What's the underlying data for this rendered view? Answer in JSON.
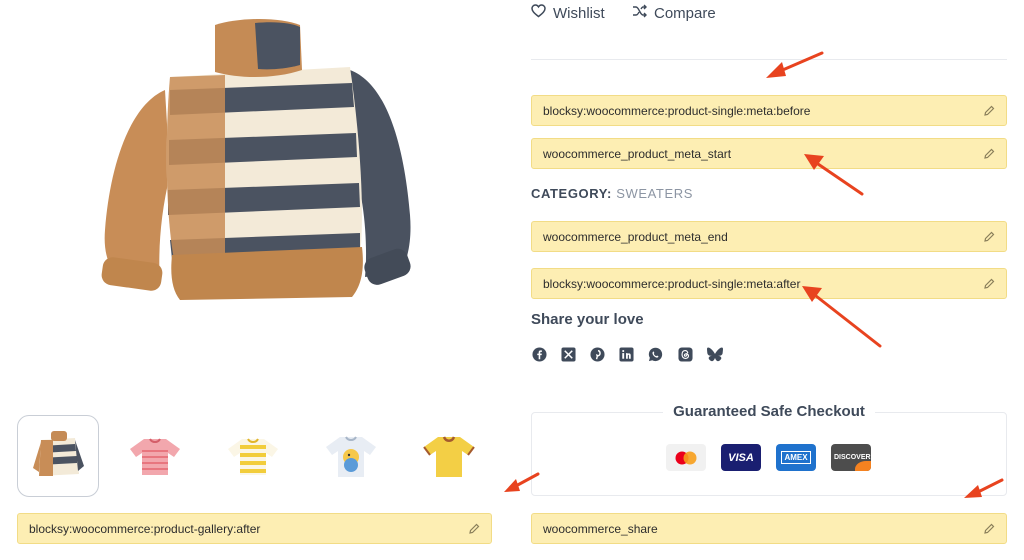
{
  "actions": {
    "wishlist_label": "Wishlist",
    "compare_label": "Compare"
  },
  "hooks": {
    "meta_before": "blocksy:woocommerce:product-single:meta:before",
    "meta_start": "woocommerce_product_meta_start",
    "meta_end": "woocommerce_product_meta_end",
    "meta_after": "blocksy:woocommerce:product-single:meta:after",
    "gallery_after": "blocksy:woocommerce:product-gallery:after",
    "share": "woocommerce_share"
  },
  "category": {
    "label": "CATEGORY:",
    "value": "Sweaters"
  },
  "share": {
    "title": "Share your love",
    "icons": [
      "facebook-icon",
      "x-icon",
      "pinterest-icon",
      "linkedin-icon",
      "whatsapp-icon",
      "threads-icon",
      "bluesky-icon"
    ]
  },
  "checkout": {
    "title": "Guaranteed Safe Checkout",
    "cards": [
      "mastercard",
      "VISA",
      "AMEX",
      "DISCOVER"
    ]
  },
  "gallery": {
    "thumbnails": [
      "striped-sweater",
      "pink-striped-tee",
      "yellow-striped-tee",
      "duck-print-tee",
      "yellow-tee"
    ]
  },
  "colors": {
    "hook_bg": "#fdeeb3",
    "hook_border": "#f2dc86",
    "arrow": "#e8431f",
    "text": "#3f4a5a",
    "muted": "#8c95a3"
  }
}
